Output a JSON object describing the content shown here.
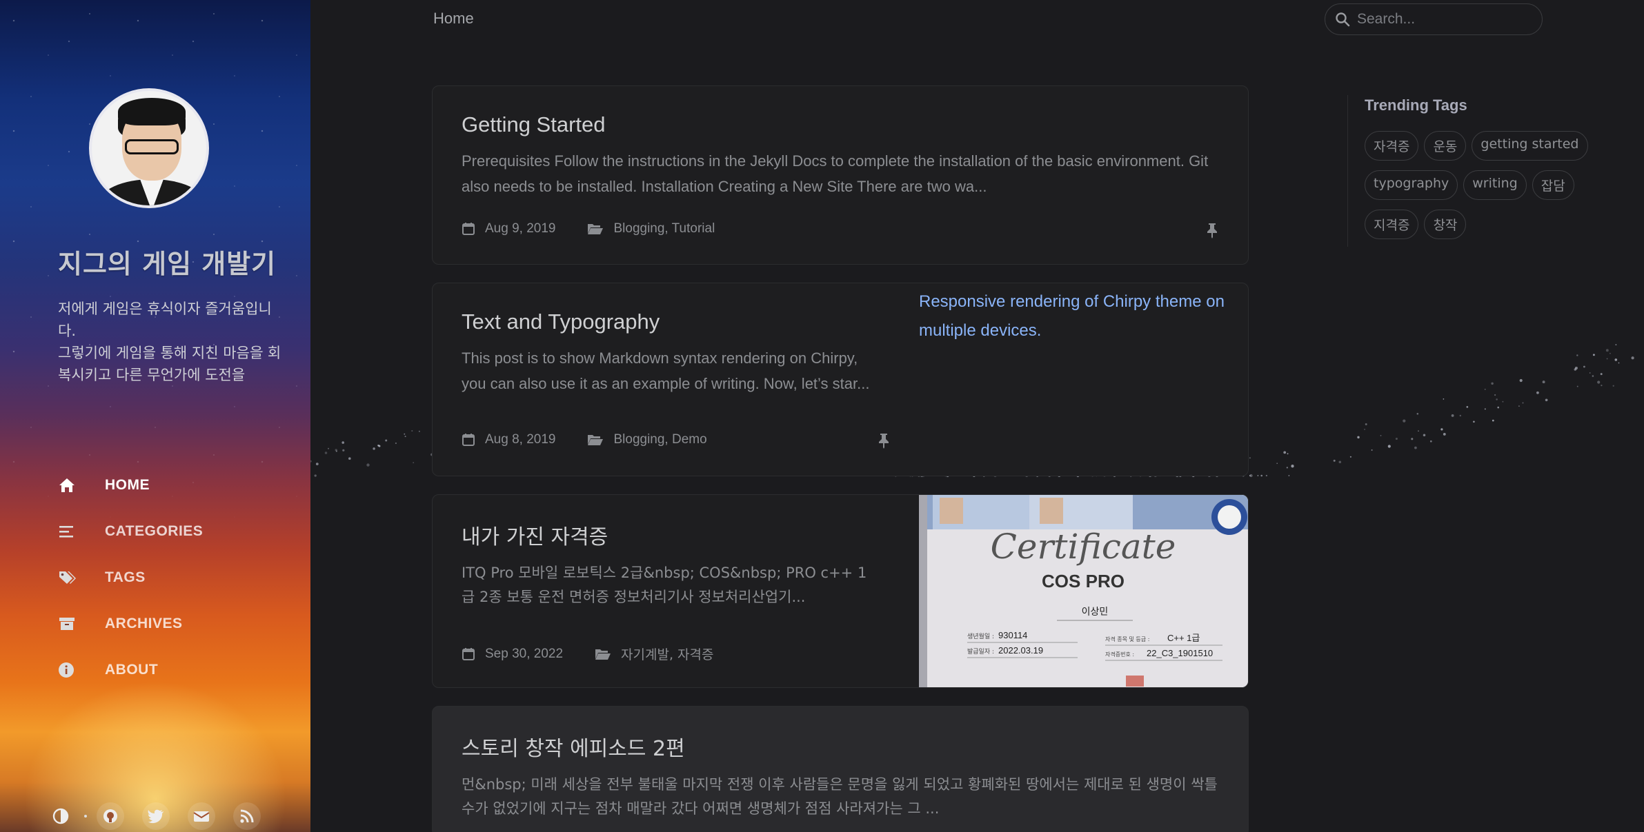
{
  "sidebar": {
    "title": "지그의 게임 개발기",
    "subtitle": "저에게 게임은 휴식이자 즐거움입니다.\n그렇기에 게임을 통해 지친 마음을 회복시키고 다른 무언가에 도전을",
    "nav": [
      {
        "label": "HOME",
        "icon": "home-icon"
      },
      {
        "label": "CATEGORIES",
        "icon": "stream-icon"
      },
      {
        "label": "TAGS",
        "icon": "tags-icon"
      },
      {
        "label": "ARCHIVES",
        "icon": "archive-icon"
      },
      {
        "label": "ABOUT",
        "icon": "info-icon"
      }
    ],
    "bottom_icons": [
      "theme-toggle-icon",
      "github-icon",
      "twitter-icon",
      "email-icon",
      "rss-icon"
    ]
  },
  "topbar": {
    "breadcrumb": "Home",
    "search_placeholder": "Search..."
  },
  "posts": [
    {
      "title": "Getting Started",
      "excerpt": "Prerequisites Follow the instructions in the Jekyll Docs to complete the installation of the basic environment. Git also needs to be installed. Installation Creating a New Site There are two wa...",
      "date": "Aug 9, 2019",
      "categories": "Blogging, Tutorial",
      "pinned": true
    },
    {
      "title": "Text and Typography",
      "excerpt": "This post is to show Markdown syntax rendering on Chirpy, you can also use it as an example of writing. Now, let’s star...",
      "date": "Aug 8, 2019",
      "categories": "Blogging, Demo",
      "pinned": true,
      "image_alt": "Responsive rendering of Chirpy theme on multiple devices."
    },
    {
      "title": "내가 가진 자격증",
      "excerpt": "ITQ Pro 모바일 로보틱스 2급&nbsp; COS&nbsp; PRO c++ 1급 2종 보통 운전 면허증 정보처리기사 정보처리산업기...",
      "date": "Sep 30, 2022",
      "categories": "자기계발, 자격증",
      "pinned": false,
      "image": {
        "cert_title": "Certificate",
        "cert_name": "COS PRO",
        "holder": "이상민",
        "birth_label": "생년월일 :",
        "birth": "930114",
        "issue_label": "발급일자 :",
        "issue": "2022.03.19",
        "grade_label": "자격 종목 및 등급 :",
        "grade": "C++ 1급",
        "cert_no_label": "자격증번호 :",
        "cert_no": "22_C3_1901510"
      }
    },
    {
      "title": "스토리 창작 에피소드 2편",
      "excerpt": "먼&nbsp; 미래 세상을 전부 불태울 마지막 전쟁 이후 사람들은 문명을 잃게 되었고 황폐화된 땅에서는 제대로 된 생명이 싹틀 수가 없었기에 지구는 점차 매말라 갔다 어쩌면 생명체가 점점 사라져가는 그 ..."
    }
  ],
  "panel": {
    "title": "Trending Tags",
    "tags": [
      "자격증",
      "운동",
      "getting started",
      "typography",
      "writing",
      "잡담",
      "지격증",
      "창작"
    ]
  },
  "colors": {
    "background": "#1b1b1e",
    "card": "#1e1e20",
    "link": "#8ab4f8",
    "text": "#afb0b1"
  }
}
